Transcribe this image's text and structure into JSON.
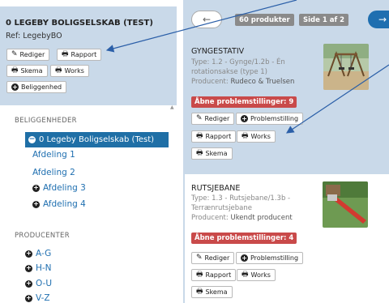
{
  "org": {
    "title": "0 LEGEBY BOLIGSELSKAB (TEST)",
    "ref": "Ref: LegebyBO",
    "buttons": {
      "edit": "Rediger",
      "report": "Rapport",
      "schema": "Skema",
      "works": "Works",
      "location": "Beliggenhed"
    }
  },
  "tree": {
    "heading": "BELIGGENHEDER",
    "active": "0 Legeby Boligselskab (Test)",
    "items": [
      "Afdeling 1",
      "Afdeling 2",
      "Afdeling 3",
      "Afdeling 4"
    ]
  },
  "producers": {
    "heading": "PRODUCENTER",
    "items": [
      "A-G",
      "H-N",
      "O-U",
      "V-Z"
    ]
  },
  "pager": {
    "count": "60 produkter",
    "page": "Side 1 af 2",
    "prev": "←",
    "next": "→"
  },
  "cards": [
    {
      "title": "GYNGESTATIV",
      "type_label": "Type:",
      "type_value": "1.2 - Gynge/1.2b - Én rotationsakse (type 1)",
      "producer_label": "Producent:",
      "producer_value": "Rudeco & Truelsen",
      "alert": "Åbne problemstillinger: 9",
      "buttons": {
        "edit": "Rediger",
        "problem": "Problemstilling",
        "report": "Rapport",
        "works": "Works",
        "schema": "Skema"
      }
    },
    {
      "title": "RUTSJEBANE",
      "type_label": "Type:",
      "type_value": "1.3 - Rutsjebane/1.3b - Terrænrutsjebane",
      "producer_label": "Producent:",
      "producer_value": "Ukendt producent",
      "alert": "Åbne problemstillinger: 4",
      "buttons": {
        "edit": "Rediger",
        "problem": "Problemstilling",
        "report": "Rapport",
        "works": "Works",
        "schema": "Skema"
      }
    }
  ],
  "colors": {
    "panel": "#c9d9e9",
    "accent": "#1f6fb0",
    "alert": "#c94a4a",
    "badge": "#8a8a8a"
  }
}
